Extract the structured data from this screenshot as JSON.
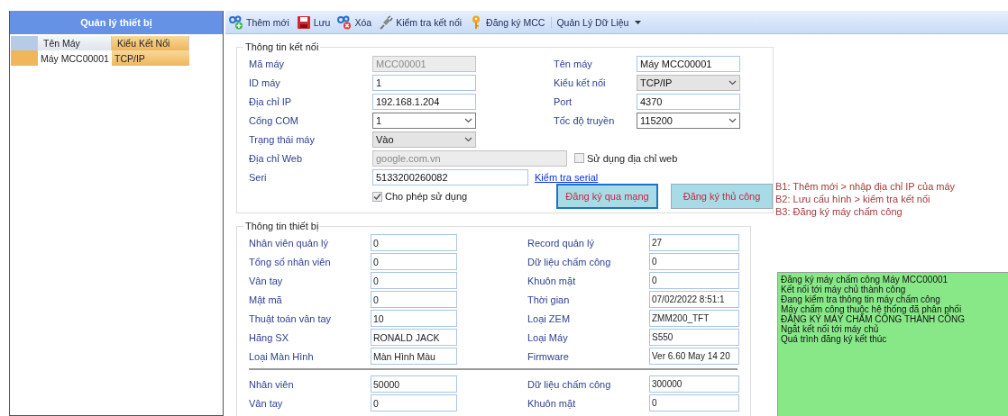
{
  "sidebar": {
    "title": "Quản lý thiết bị",
    "columns": [
      {
        "label": "Tên Máy",
        "highlighted": false
      },
      {
        "label": "Kiểu Kết Nối",
        "highlighted": true
      }
    ],
    "rows": [
      {
        "cells": [
          "Máy MCC00001",
          "TCP/IP"
        ],
        "selected": true
      }
    ]
  },
  "toolbar": [
    {
      "kind": "add",
      "label": "Thêm mới"
    },
    {
      "kind": "save",
      "label": "Lưu"
    },
    {
      "kind": "delete",
      "label": "Xóa"
    },
    {
      "kind": "plug",
      "label": "Kiểm tra kết nối"
    },
    {
      "kind": "key",
      "label": "Đăng ký MCC"
    },
    {
      "kind": "dropdown",
      "label": "Quản Lý Dữ Liệu"
    }
  ],
  "connection": {
    "title": "Thông tin kết nối",
    "rows": [
      {
        "left": {
          "label": "Mã máy",
          "kind": "input",
          "value": "MCC00001",
          "disabled": true
        },
        "right": {
          "label": "Tên máy",
          "kind": "input",
          "value": "Máy MCC00001",
          "disabled": false
        }
      },
      {
        "left": {
          "label": "ID máy",
          "kind": "input",
          "value": "1",
          "disabled": false
        },
        "right": {
          "label": "Kiểu kết nối",
          "kind": "select",
          "value": "TCP/IP",
          "disabled": true
        }
      },
      {
        "left": {
          "label": "Địa chỉ IP",
          "kind": "input",
          "value": "192.168.1.204",
          "disabled": false
        },
        "right": {
          "label": "Port",
          "kind": "input",
          "value": "4370",
          "disabled": false
        }
      },
      {
        "left": {
          "label": "Cổng COM",
          "kind": "select",
          "value": "1",
          "disabled": false
        },
        "right": {
          "label": "Tốc độ truyền",
          "kind": "select",
          "value": "115200",
          "disabled": false
        }
      },
      {
        "left": {
          "label": "Trạng thái máy",
          "kind": "select",
          "value": "Vào",
          "disabled": true
        }
      },
      {
        "left": {
          "label": "Địa chỉ Web",
          "kind": "wide-input",
          "value": "google.com.vn",
          "disabled": true
        },
        "extra": {
          "kind": "checkbox",
          "label": "Sử dụng địa chỉ web",
          "checked": false
        }
      },
      {
        "left": {
          "label": "Seri",
          "kind": "medium-input",
          "value": "5133200260082",
          "disabled": false
        },
        "extra": {
          "kind": "link",
          "label": "Kiểm tra serial"
        }
      }
    ],
    "allow_use": {
      "label": "Cho phép sử dụng",
      "checked": true
    },
    "buttons": [
      {
        "label": "Đăng ký qua mạng",
        "focused": true
      },
      {
        "label": "Đăng ký thủ công",
        "focused": false
      }
    ]
  },
  "device": {
    "title": "Thông tin thiết bị",
    "groups": [
      [
        {
          "label": "Nhân viên quản lý",
          "value": "0"
        },
        {
          "label": "Record quản lý",
          "value": "27"
        },
        {
          "label": "Tổng số nhân viên",
          "value": "0"
        },
        {
          "label": "Dữ liệu chấm công",
          "value": "0"
        },
        {
          "label": "Vân tay",
          "value": "0"
        },
        {
          "label": "Khuôn mặt",
          "value": "0"
        },
        {
          "label": "Mật mã",
          "value": "0"
        },
        {
          "label": "Thời gian",
          "value": "07/02/2022 8:51:1"
        },
        {
          "label": "Thuật toán vân tay",
          "value": "10"
        },
        {
          "label": "Loại ZEM",
          "value": "ZMM200_TFT"
        },
        {
          "label": "Hãng SX",
          "value": "RONALD JACK"
        },
        {
          "label": "Loại Máy",
          "value": "S550"
        },
        {
          "label": "Loại Màn Hình",
          "value": "Màn Hình Màu"
        },
        {
          "label": "Firmware",
          "value": "Ver 6.60 May 14 20"
        }
      ],
      [
        {
          "label": "Nhân viên",
          "value": "50000"
        },
        {
          "label": "Dữ liệu chấm công",
          "value": "300000"
        },
        {
          "label": "Vân tay",
          "value": "0"
        },
        {
          "label": "Khuôn mặt",
          "value": "0"
        }
      ]
    ]
  },
  "notes": [
    "B1: Thêm mới > nhập địa chỉ IP của máy",
    "B2: Lưu cấu hình > kiểm tra kết nối",
    "B3: Đăng ký máy chấm công"
  ],
  "log": [
    "Đăng ký máy chấm công Máy MCC00001",
    "Kết nối tới máy chủ thành công",
    "Đang kiểm tra thông tin máy chấm công",
    "Máy chấm công thuộc hệ thống đã phân phối",
    "ĐĂNG KÝ MÁY CHẤM CÔNG THÀNH CÔNG",
    "Ngắt kết nối tới máy chủ",
    "Quá trình đăng ký kết thúc"
  ]
}
